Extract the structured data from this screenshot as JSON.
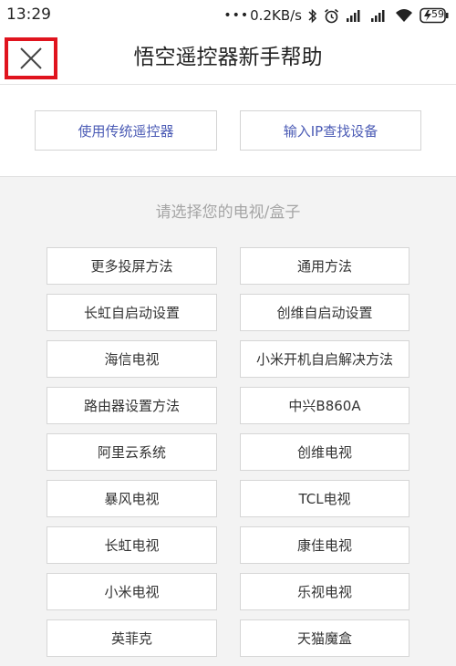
{
  "status_bar": {
    "time": "13:29",
    "net_speed": "0.2KB/s",
    "battery": "59"
  },
  "header": {
    "title": "悟空遥控器新手帮助",
    "close_icon": "close-icon",
    "close_highlight_color": "#e0141e"
  },
  "top_buttons": {
    "traditional_remote": "使用传统遥控器",
    "ip_search": "输入IP查找设备"
  },
  "prompt": "请选择您的电视/盒子",
  "options": [
    [
      "更多投屏方法",
      "通用方法"
    ],
    [
      "长虹自启动设置",
      "创维自启动设置"
    ],
    [
      "海信电视",
      "小米开机自启解决方法"
    ],
    [
      "路由器设置方法",
      "中兴B860A"
    ],
    [
      "阿里云系统",
      "创维电视"
    ],
    [
      "暴风电视",
      "TCL电视"
    ],
    [
      "长虹电视",
      "康佳电视"
    ],
    [
      "小米电视",
      "乐视电视"
    ],
    [
      "英菲克",
      "天猫魔盒"
    ]
  ],
  "colors": {
    "accent_text": "#4b5bb5",
    "background": "#f3f3f3"
  }
}
